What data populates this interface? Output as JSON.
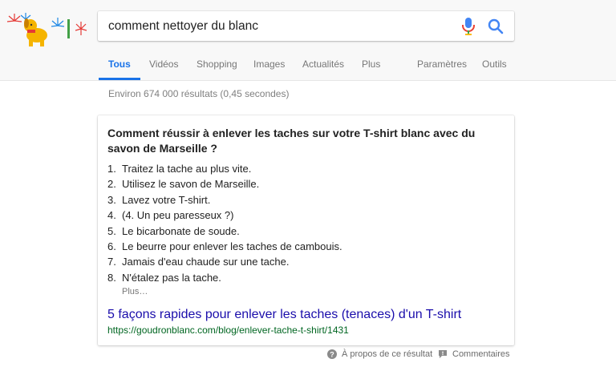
{
  "search": {
    "query": "comment nettoyer du blanc"
  },
  "icons": {
    "doodle": "festive-dog-fireworks-doodle",
    "mic": "microphone-icon",
    "search": "magnifier-icon",
    "about": "help-circle-icon",
    "feedback": "feedback-icon"
  },
  "colors": {
    "accent": "#1a73e8",
    "link": "#1a0dab",
    "url": "#006621"
  },
  "tabs": [
    {
      "label": "Tous",
      "active": true
    },
    {
      "label": "Vidéos"
    },
    {
      "label": "Shopping"
    },
    {
      "label": "Images"
    },
    {
      "label": "Actualités"
    },
    {
      "label": "Plus"
    },
    {
      "label": "Paramètres"
    },
    {
      "label": "Outils"
    }
  ],
  "results_stats": "Environ 674 000 résultats (0,45 secondes)",
  "snippet": {
    "title": "Comment réussir à enlever les taches sur votre T-shirt blanc avec du savon de Marseille ?",
    "steps": [
      {
        "num": "1.",
        "text": "Traitez la tache au plus vite."
      },
      {
        "num": "2.",
        "text": "Utilisez le savon de Marseille."
      },
      {
        "num": "3.",
        "text": "Lavez votre T-shirt."
      },
      {
        "num": "4.",
        "text": "(4. Un peu paresseux ?)"
      },
      {
        "num": "5.",
        "text": "Le bicarbonate de soude."
      },
      {
        "num": "6.",
        "text": "Le beurre pour enlever les taches de cambouis."
      },
      {
        "num": "7.",
        "text": "Jamais d'eau chaude sur une tache."
      },
      {
        "num": "8.",
        "text": "N'étalez pas la tache."
      }
    ],
    "more_label": "Plus…",
    "link_title": "5 façons rapides pour enlever les taches (tenaces) d'un T-shirt",
    "url": "https://goudronblanc.com/blog/enlever-tache-t-shirt/1431"
  },
  "footer": {
    "about": "À propos de ce résultat",
    "feedback": "Commentaires"
  }
}
